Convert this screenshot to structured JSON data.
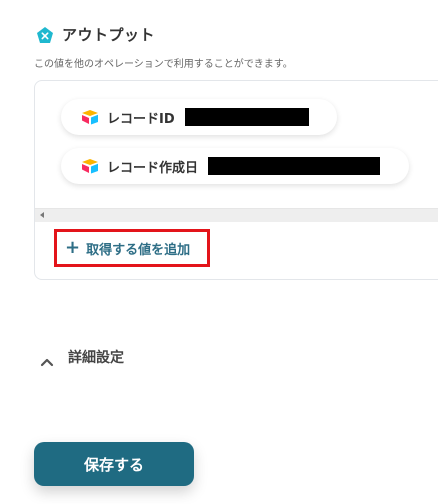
{
  "section": {
    "icon": "pentagon-x-icon",
    "title": "アウトプット",
    "description": "この値を他のオペレーションで利用することができます。"
  },
  "output": {
    "chips": [
      {
        "icon": "airtable-icon",
        "label": "レコードID"
      },
      {
        "icon": "airtable-icon",
        "label": "レコード作成日"
      }
    ],
    "add_value_label": "取得する値を追加"
  },
  "advanced": {
    "label": "詳細設定"
  },
  "actions": {
    "save_label": "保存する"
  },
  "colors": {
    "accent": "#1f6b82",
    "link": "#2e6e86",
    "highlight": "#e3141a",
    "icon_teal": "#1fb8cf"
  }
}
